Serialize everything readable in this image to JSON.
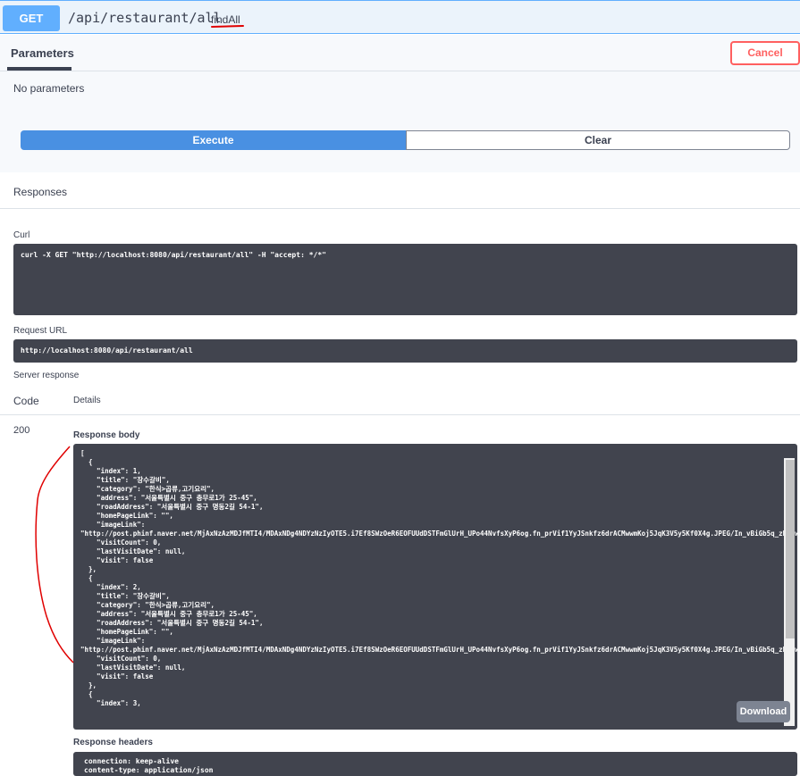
{
  "operation": {
    "method": "GET",
    "path": "/api/restaurant/all",
    "operation_id": "findAll"
  },
  "parameters": {
    "tab_label": "Parameters",
    "cancel_label": "Cancel",
    "empty_text": "No parameters"
  },
  "actions": {
    "execute_label": "Execute",
    "clear_label": "Clear"
  },
  "responses": {
    "title": "Responses",
    "curl_label": "Curl",
    "curl_command": "curl -X GET \"http://localhost:8080/api/restaurant/all\" -H \"accept: */*\"",
    "request_url_label": "Request URL",
    "request_url": "http://localhost:8080/api/restaurant/all",
    "server_response_label": "Server response",
    "code_header": "Code",
    "details_header": "Details",
    "status_code": "200",
    "response_body_label": "Response body",
    "response_body": "[\n  {\n    \"index\": 1,\n    \"title\": \"장수갈비\",\n    \"category\": \"한식>곱류,고기요리\",\n    \"address\": \"서울특별시 중구 충무로1가 25-45\",\n    \"roadAddress\": \"서울특별시 중구 명동2길 54-1\",\n    \"homePageLink\": \"\",\n    \"imageLink\":\n\"http://post.phinf.naver.net/MjAxNzAzMDJfMTI4/MDAxNDg4NDYzNzIyOTE5.i7Ef8SWzOeR6EOFUUdDSTFmGlUrH_UPo44NvfsXyP6og.fn_prVif1YyJSnkfz6drACMwwmKoj5JqK3V5y5Kf0X4g.JPEG/In_vBiGb5q_zbCmwJigQqkzuh7hA.jpg\",\n    \"visitCount\": 0,\n    \"lastVisitDate\": null,\n    \"visit\": false\n  },\n  {\n    \"index\": 2,\n    \"title\": \"장수갈비\",\n    \"category\": \"한식>곱류,고기요리\",\n    \"address\": \"서울특별시 중구 충무로1가 25-45\",\n    \"roadAddress\": \"서울특별시 중구 명동2길 54-1\",\n    \"homePageLink\": \"\",\n    \"imageLink\":\n\"http://post.phinf.naver.net/MjAxNzAzMDJfMTI4/MDAxNDg4NDYzNzIyOTE5.i7Ef8SWzOeR6EOFUUdDSTFmGlUrH_UPo44NvfsXyP6og.fn_prVif1YyJSnkfz6drACMwwmKoj5JqK3V5y5Kf0X4g.JPEG/In_vBiGb5q_zbCmwJigQqkzuh7hA.jpg\",\n    \"visitCount\": 0,\n    \"lastVisitDate\": null,\n    \"visit\": false\n  },\n  {\n    \"index\": 3,",
    "download_label": "Download",
    "response_headers_label": "Response headers",
    "header_lines": [
      "connection: keep-alive",
      "content-type: application/json"
    ]
  },
  "colors": {
    "get_accent": "#61affe",
    "execute_blue": "#4990e2",
    "cancel_red": "#ff6060",
    "code_bg": "#41444e",
    "annotation_red": "#e00000"
  }
}
